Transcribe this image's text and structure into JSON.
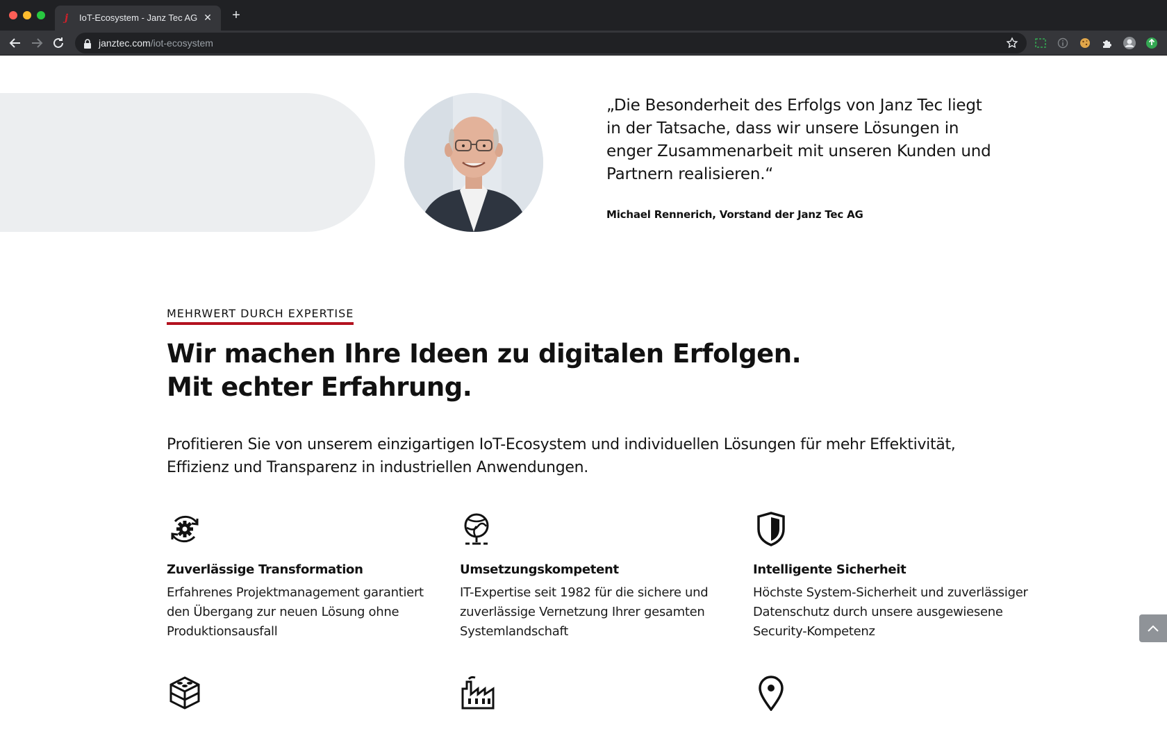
{
  "browser": {
    "tab_title": "IoT-Ecosystem - Janz Tec AG",
    "tab_favicon": "j",
    "tab_close": "✕",
    "new_tab": "+",
    "url_host": "janztec.com",
    "url_path": "/iot-ecosystem"
  },
  "testimonial": {
    "quote": "„Die Besonderheit des Erfolgs von Janz Tec liegt in der Tatsache, dass wir unsere Lösungen in enger Zusammenarbeit mit unseren Kunden und Partnern realisieren.“",
    "author": "Michael Rennerich, Vorstand der Janz Tec AG"
  },
  "expertise": {
    "eyebrow": "MEHRWERT DURCH EXPERTISE",
    "headline_line1": "Wir machen Ihre Ideen zu digitalen Erfolgen.",
    "headline_line2": "Mit echter Erfahrung.",
    "lead": "Profitieren Sie von unserem einzigartigen IoT-Ecosystem und individuellen Lösungen für mehr Effektivität, Effizienz und Transparenz in industriellen Anwendungen."
  },
  "features": [
    {
      "icon": "gear-cycle-icon",
      "title": "Zuverlässige Transformation",
      "desc": "Erfahrenes Projektmanagement garantiert den Übergang zur neuen Lösung ohne Produktionsausfall"
    },
    {
      "icon": "globe-network-icon",
      "title": "Umsetzungskompetent",
      "desc": "IT-Expertise seit 1982 für die sichere und zuverlässige Vernetzung Ihrer gesamten Systemlandschaft"
    },
    {
      "icon": "shield-icon",
      "title": "Intelligente Sicherheit",
      "desc": "Höchste System-Sicherheit und zuverlässiger Datenschutz durch unsere ausgewiesene Security-Kompetenz"
    },
    {
      "icon": "building-blocks-icon"
    },
    {
      "icon": "factory-icon"
    },
    {
      "icon": "location-pin-icon"
    }
  ],
  "colors": {
    "accent_red": "#b3121f",
    "band_gray": "#eceef0",
    "scroll_button": "#8f9398"
  }
}
